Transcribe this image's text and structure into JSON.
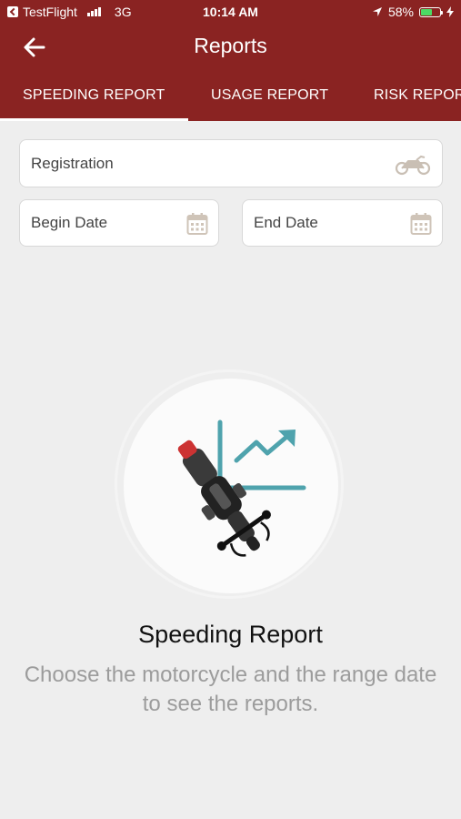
{
  "status_bar": {
    "carrier": "TestFlight",
    "network": "3G",
    "time": "10:14 AM",
    "battery": "58%",
    "battery_level": 0.58
  },
  "header": {
    "title": "Reports"
  },
  "tabs": [
    {
      "label": "SPEEDING REPORT",
      "active": true
    },
    {
      "label": "USAGE REPORT",
      "active": false
    },
    {
      "label": "RISK REPORT",
      "active": false
    }
  ],
  "form": {
    "registration": {
      "placeholder": "Registration",
      "value": "",
      "icon": "motorcycle-icon"
    },
    "begin_date": {
      "placeholder": "Begin Date",
      "value": "",
      "icon": "calendar-icon"
    },
    "end_date": {
      "placeholder": "End Date",
      "value": "",
      "icon": "calendar-icon"
    }
  },
  "empty_state": {
    "title": "Speeding Report",
    "description": "Choose the motorcycle and the range date to see the reports."
  },
  "colors": {
    "primary": "#8a2322",
    "background": "#eeeeee",
    "chart_accent": "#4fa3ad"
  }
}
